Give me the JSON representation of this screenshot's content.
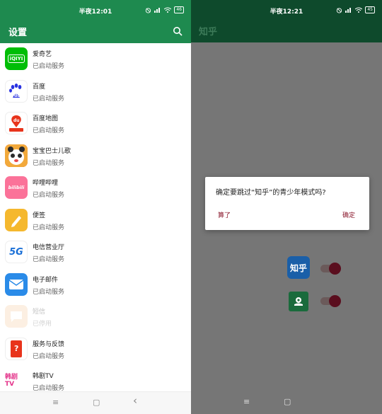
{
  "left": {
    "status_time": "半夜12:01",
    "status_icons": "⦸ ▂▄▆ •",
    "battery": "46",
    "title": "设置",
    "apps": [
      {
        "name": "爱奇艺",
        "status": "已启动服务",
        "icon_text": "iQIYI",
        "icon_bg": "#00be06"
      },
      {
        "name": "百度",
        "status": "已启动服务",
        "icon_text": "du",
        "icon_bg": "#ffffff"
      },
      {
        "name": "百度地图",
        "status": "已启动服务",
        "icon_text": "du",
        "icon_bg": "#ffffff"
      },
      {
        "name": "宝宝巴士儿歌",
        "status": "已启动服务",
        "icon_text": "",
        "icon_bg": "#e84b4b"
      },
      {
        "name": "哔哩哔哩",
        "status": "已启动服务",
        "icon_text": "bilibili",
        "icon_bg": "#fb7299"
      },
      {
        "name": "便签",
        "status": "已启动服务",
        "icon_text": "",
        "icon_bg": "#f5b82e"
      },
      {
        "name": "电信营业厅",
        "status": "已启动服务",
        "icon_text": "5G",
        "icon_bg": "#ffffff"
      },
      {
        "name": "电子邮件",
        "status": "已启动服务",
        "icon_text": "",
        "icon_bg": "#2a8be8"
      },
      {
        "name": "短信",
        "status": "已停用",
        "icon_text": "",
        "icon_bg": "#f5c89a"
      },
      {
        "name": "服务与反馈",
        "status": "已启动服务",
        "icon_text": "?",
        "icon_bg": "#ffffff"
      },
      {
        "name": "韩剧TV",
        "status": "已启动服务",
        "icon_text": "韩剧 TV",
        "icon_bg": "#ffffff"
      }
    ],
    "nav": {
      "menu": "≡",
      "home": "▢",
      "back": "‹"
    }
  },
  "right": {
    "status_time": "半夜12:21",
    "battery": "45",
    "title": "知乎",
    "dialog": {
      "message": "确定要跳过“知乎”的青少年模式吗?",
      "cancel": "算了",
      "ok": "确定"
    },
    "zhihu_icon_text": "知乎",
    "nav": {
      "menu": "≡",
      "home": "▢"
    }
  }
}
